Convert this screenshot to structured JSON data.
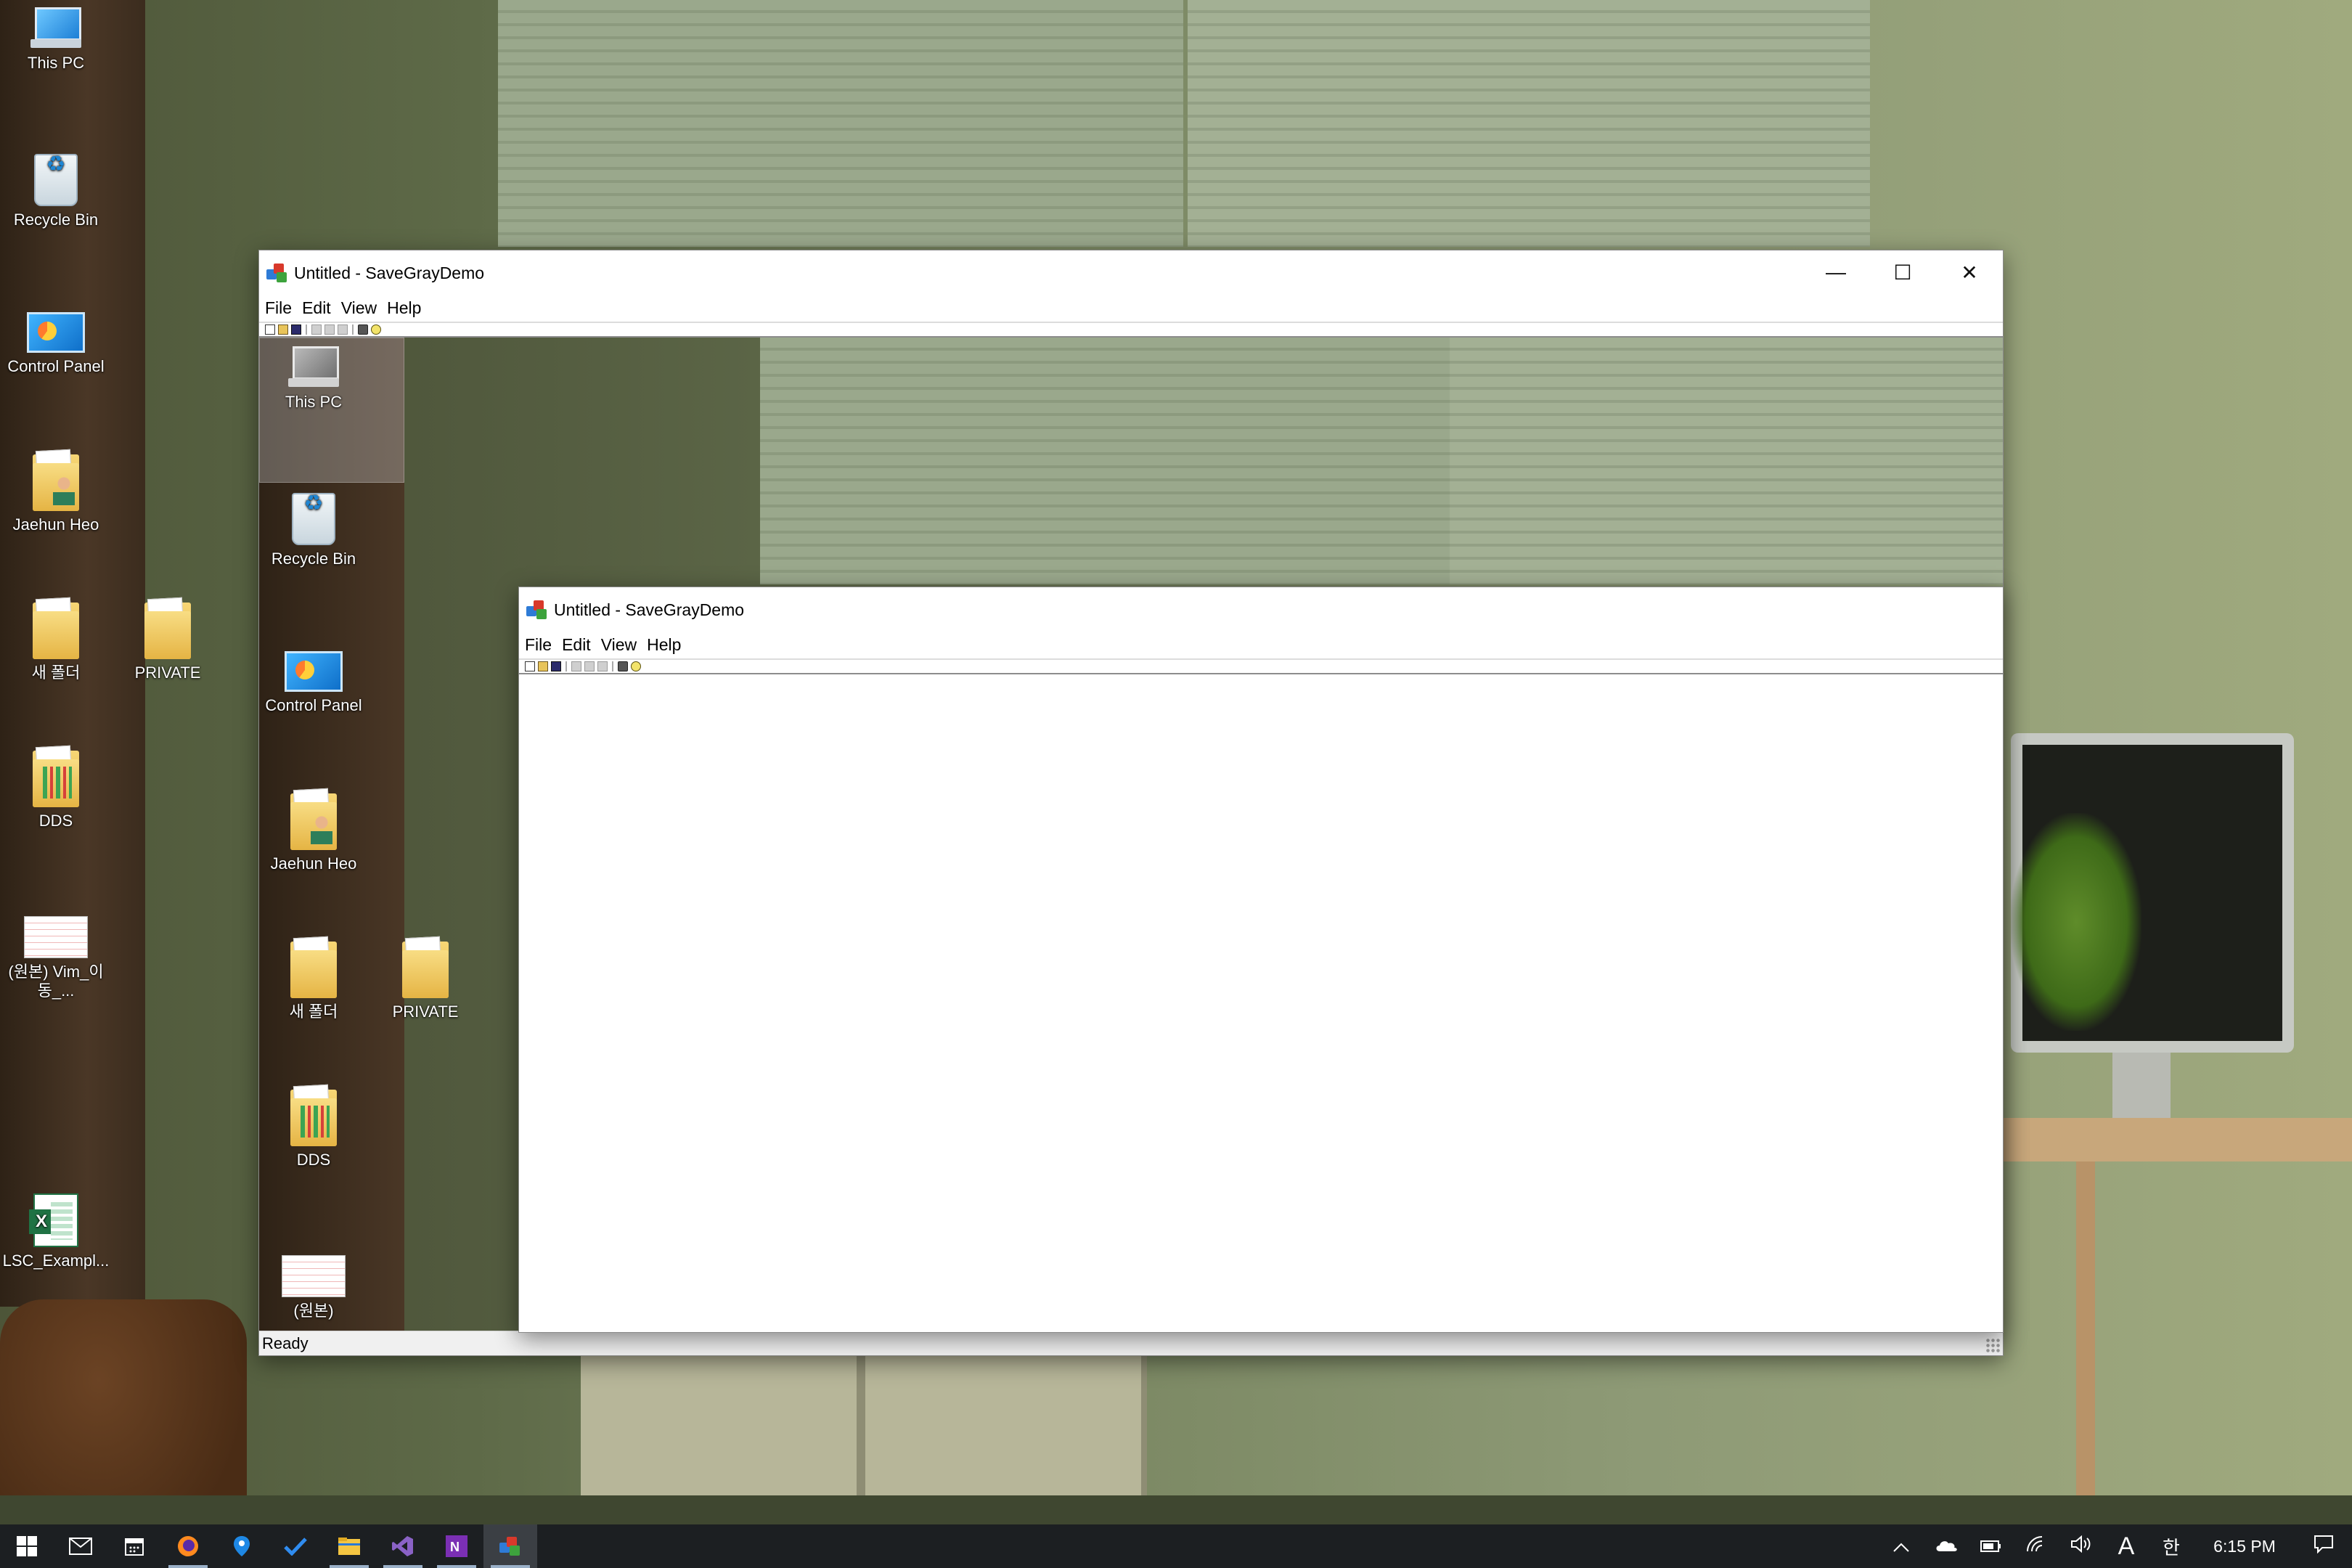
{
  "desktop": {
    "icons": [
      {
        "label": "This PC",
        "icon": "this-pc-icon"
      },
      {
        "label": "Recycle Bin",
        "icon": "recycle-bin-icon"
      },
      {
        "label": "Control Panel",
        "icon": "control-panel-icon"
      },
      {
        "label": "Jaehun Heo",
        "icon": "user-folder-icon"
      },
      {
        "label": "새 폴더",
        "icon": "folder-icon"
      },
      {
        "label": "PRIVATE",
        "icon": "folder-icon"
      },
      {
        "label": "DDS",
        "icon": "folder-icon"
      },
      {
        "label": "(원본) Vim_이동_...",
        "icon": "document-thumbnail-icon"
      },
      {
        "label": "LSC_Exampl...",
        "icon": "excel-file-icon"
      }
    ],
    "captured_icons": [
      {
        "label": "This PC"
      },
      {
        "label": "Recycle Bin"
      },
      {
        "label": "Control Panel"
      },
      {
        "label": "Jaehun Heo"
      },
      {
        "label": "새 폴더"
      },
      {
        "label": "PRIVATE"
      },
      {
        "label": "DDS"
      },
      {
        "label": "(원본)"
      }
    ]
  },
  "outer_window": {
    "title": "Untitled - SaveGrayDemo",
    "menu": [
      "File",
      "Edit",
      "View",
      "Help"
    ],
    "status": "Ready",
    "controls": {
      "minimize": "—",
      "maximize": "☐",
      "close": "✕"
    }
  },
  "inner_window": {
    "title": "Untitled - SaveGrayDemo",
    "menu": [
      "File",
      "Edit",
      "View",
      "Help"
    ]
  },
  "taskbar": {
    "apps": [
      "start-icon",
      "mail-icon",
      "calendar-icon",
      "firefox-icon",
      "maps-icon",
      "todo-icon",
      "file-explorer-icon",
      "visual-studio-icon",
      "onenote-icon",
      "savegraydemo-icon"
    ],
    "active_app": "savegraydemo-icon",
    "tray": {
      "input_indicator": "A",
      "ime_indicator": "한",
      "time": "6:15 PM"
    }
  }
}
